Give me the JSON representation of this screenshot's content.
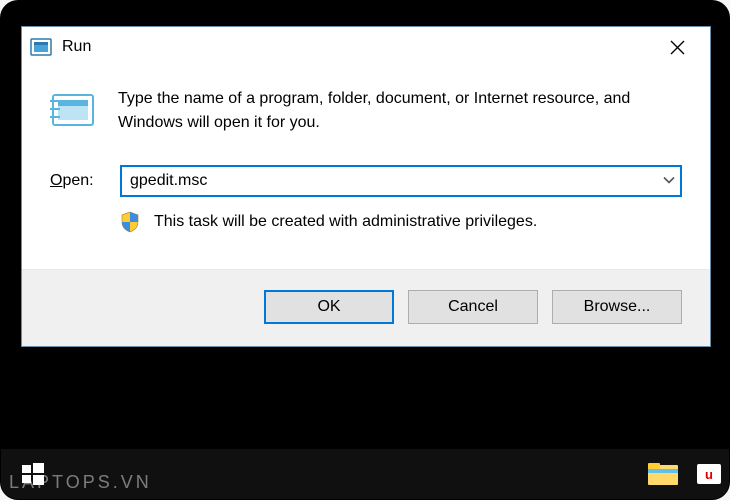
{
  "dialog": {
    "title": "Run",
    "instruction": "Type the name of a program, folder, document, or Internet resource, and Windows will open it for you.",
    "open_label_prefix": "O",
    "open_label_suffix": "pen:",
    "input_value": "gpedit.msc",
    "admin_message": "This task will be created with administrative privileges.",
    "buttons": {
      "ok": "OK",
      "cancel": "Cancel",
      "browse": "Browse..."
    }
  },
  "watermark": "LAPTOPS.VN"
}
